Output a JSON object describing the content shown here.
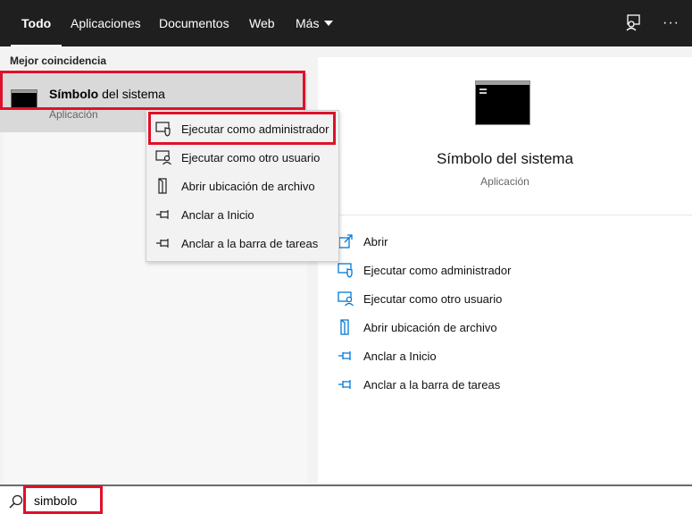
{
  "tabs": [
    {
      "label": "Todo",
      "active": true
    },
    {
      "label": "Aplicaciones"
    },
    {
      "label": "Documentos"
    },
    {
      "label": "Web"
    },
    {
      "label": "Más",
      "dropdown": true
    }
  ],
  "top_icons": [
    "feedback-icon",
    "more-options-icon"
  ],
  "top_more_label": "···",
  "best_match": {
    "section_label": "Mejor coincidencia",
    "title_bold": "Símbolo",
    "title_rest": " del sistema",
    "subtitle": "Aplicación",
    "icon": "command-prompt-icon"
  },
  "context_menu": [
    {
      "label": "Ejecutar como administrador",
      "icon": "shield-icon"
    },
    {
      "label": "Ejecutar como otro usuario",
      "icon": "user-run-icon"
    },
    {
      "label": "Abrir ubicación de archivo",
      "icon": "file-location-icon"
    },
    {
      "label": "Anclar a Inicio",
      "icon": "pin-icon"
    },
    {
      "label": "Anclar a la barra de tareas",
      "icon": "pin-icon"
    }
  ],
  "details": {
    "title": "Símbolo del sistema",
    "subtitle": "Aplicación",
    "icon": "command-prompt-icon",
    "actions": [
      {
        "label": "Abrir",
        "icon": "open-icon"
      },
      {
        "label": "Ejecutar como administrador",
        "icon": "shield-icon"
      },
      {
        "label": "Ejecutar como otro usuario",
        "icon": "user-run-icon"
      },
      {
        "label": "Abrir ubicación de archivo",
        "icon": "file-location-icon"
      },
      {
        "label": "Anclar a Inicio",
        "icon": "pin-icon"
      },
      {
        "label": "Anclar a la barra de tareas",
        "icon": "pin-icon"
      }
    ]
  },
  "search": {
    "value": "simbolo",
    "icon": "search-icon"
  },
  "colors": {
    "accent": "#0078d7",
    "highlight": "#e0102a",
    "topbar": "#1f1f1f"
  }
}
